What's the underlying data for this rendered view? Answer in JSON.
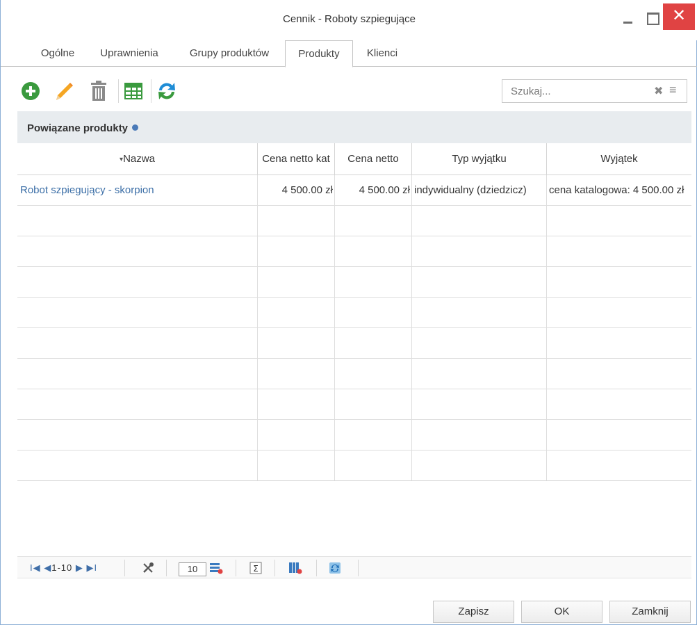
{
  "window": {
    "title": "Cennik - Roboty szpiegujące",
    "close_glyph": "✕"
  },
  "tabs": [
    {
      "label": "Ogólne",
      "active": false
    },
    {
      "label": "Uprawnienia",
      "active": false
    },
    {
      "label": "Grupy produktów",
      "active": false
    },
    {
      "label": "Produkty",
      "active": true
    },
    {
      "label": "Klienci",
      "active": false
    }
  ],
  "toolbar": {
    "icons": [
      "add-icon",
      "edit-pencil-icon",
      "delete-trash-icon",
      "table-view-icon",
      "refresh-icon"
    ],
    "search_placeholder": "Szukaj...",
    "search_value": "",
    "search_clear_glyph": "✖",
    "search_menu_glyph": "≡"
  },
  "panel": {
    "title": "Powiązane produkty"
  },
  "grid": {
    "sort_glyph": "▾",
    "columns": [
      "Nazwa",
      "Cena netto kat",
      "Cena netto",
      "Typ wyjątku",
      "Wyjątek"
    ],
    "rows": [
      {
        "name": "Robot szpiegujący - skorpion",
        "catalog_net_price": "4 500.00 zł",
        "net_price": "4 500.00 zł",
        "exception_type": "indywidualny (dziedzicz)",
        "exception": "cena katalogowa: 4 500.00 zł"
      }
    ],
    "empty_rows": 9
  },
  "pager": {
    "range": "1-10",
    "first_glyph": "I◀",
    "prev_glyph": "◀",
    "next_glyph": "▶",
    "last_glyph": "▶I",
    "page_size": "10"
  },
  "footer": {
    "save_label": "Zapisz",
    "ok_label": "OK",
    "close_label": "Zamknij"
  },
  "colors": {
    "accent": "#3c6fa7",
    "close_button": "#e04343",
    "add_green": "#3a9a3e",
    "refresh_blue": "#1f8dd6"
  }
}
